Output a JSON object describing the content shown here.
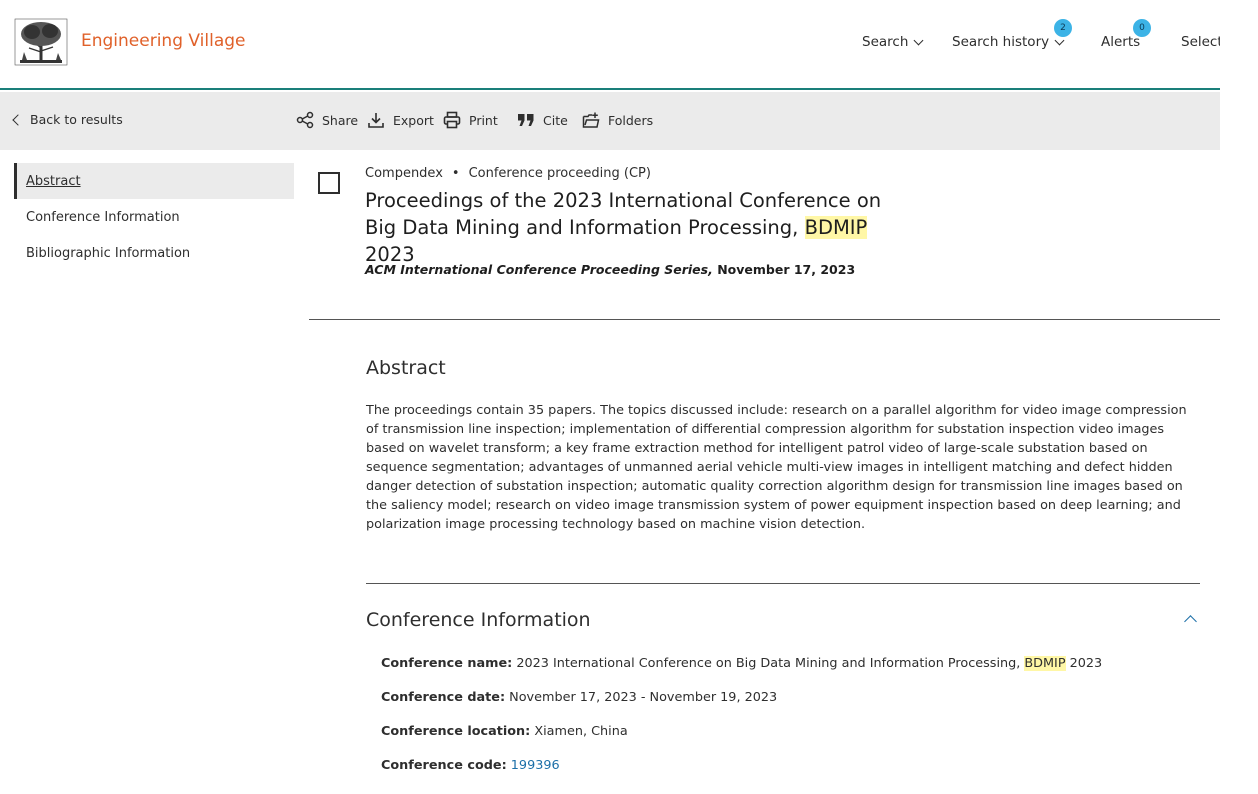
{
  "header": {
    "brand": "Engineering Village",
    "nav": [
      {
        "label": "Search",
        "has_chevron": true
      },
      {
        "label": "Search history",
        "has_chevron": true,
        "badge": "2"
      },
      {
        "label": "Alerts",
        "badge": "0"
      },
      {
        "label": "Selected"
      }
    ]
  },
  "toolbar": {
    "back_label": "Back to results",
    "actions": [
      {
        "label": "Share",
        "icon": "share-icon"
      },
      {
        "label": "Export",
        "icon": "download-icon"
      },
      {
        "label": "Print",
        "icon": "printer-icon"
      },
      {
        "label": "Cite",
        "icon": "quote-icon"
      },
      {
        "label": "Folders",
        "icon": "folder-add-icon"
      }
    ]
  },
  "sidebar": {
    "items": [
      {
        "label": "Abstract",
        "active": true
      },
      {
        "label": "Conference Information"
      },
      {
        "label": "Bibliographic Information"
      }
    ]
  },
  "record": {
    "database": "Compendex",
    "doc_type": "Conference proceeding (CP)",
    "title_before": "Proceedings of the 2023 International Conference on Big Data Mining and Information Processing, ",
    "title_highlight": "BDMIP",
    "title_after": " 2023",
    "series_italic": "ACM International Conference Proceeding Series,",
    "series_date": " November 17, 2023"
  },
  "abstract": {
    "heading": "Abstract",
    "text": "The proceedings contain 35 papers. The topics discussed include: research on a parallel algorithm for video image compression of transmission line inspection; implementation of differential compression algorithm for substation inspection video images based on wavelet transform; a key frame extraction method for intelligent patrol video of large-scale substation based on sequence segmentation; advantages of unmanned aerial vehicle multi-view images in intelligent matching and defect hidden danger detection of substation inspection; automatic quality correction algorithm design for transmission line images based on the saliency model; research on video image transmission system of power equipment inspection based on deep learning; and polarization image processing technology based on machine vision detection."
  },
  "conference": {
    "heading": "Conference Information",
    "name_label": "Conference name:",
    "name_before": " 2023 International Conference on Big Data Mining and Information Processing, ",
    "name_highlight": "BDMIP",
    "name_after": " 2023",
    "date_label": "Conference date:",
    "date_value": " November 17, 2023 - November 19, 2023",
    "location_label": "Conference location:",
    "location_value": " Xiamen, China",
    "code_label": "Conference code:",
    "code_value": "199396"
  },
  "colors": {
    "brand": "#e0612a",
    "accent_teal": "#1a7f7a",
    "badge": "#3cb3e6",
    "highlight": "#fff7a6",
    "link": "#1c6fa8"
  }
}
